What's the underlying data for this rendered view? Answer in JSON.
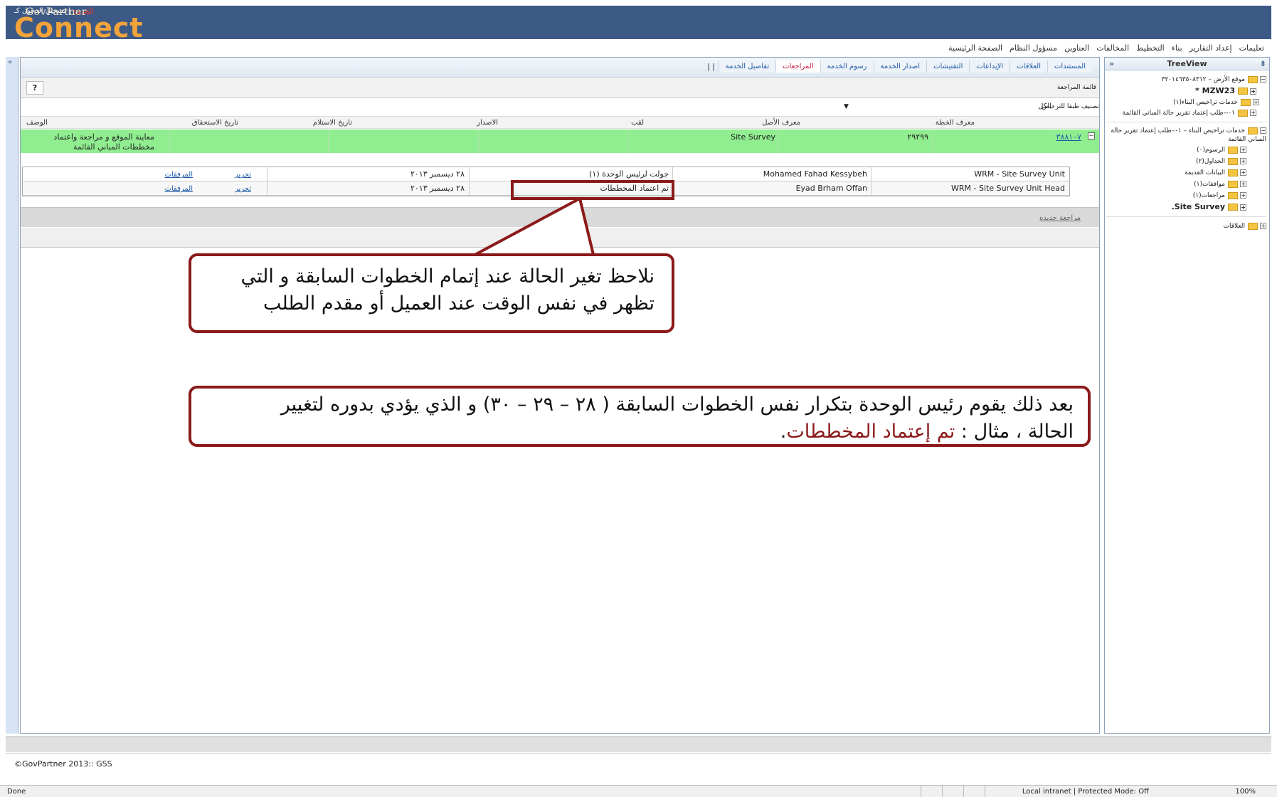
{
  "header": {
    "top_links": "تسجيل الدخول كـ",
    "logout_link": "الخروج",
    "brand_small": "GovPartner",
    "brand": "Connect"
  },
  "menu": [
    "الصفحة الرئيسية",
    "مسؤول النظام",
    "العناوين",
    "المخالفات",
    "التخطيط",
    "بناء",
    "إعداد التقارير",
    "تعليمات"
  ],
  "tabs": [
    {
      "label": "تفاصيل الخدمة",
      "active": false
    },
    {
      "label": "المراجعات",
      "active": true
    },
    {
      "label": "رسوم الخدمة",
      "active": false
    },
    {
      "label": "اصدار الخدمة",
      "active": false
    },
    {
      "label": "التفتيشات",
      "active": false
    },
    {
      "label": "الإيداعات",
      "active": false
    },
    {
      "label": "العلاقات",
      "active": false
    },
    {
      "label": "المستندات",
      "active": false
    }
  ],
  "tab_separator": "| |",
  "main": {
    "list_title": "قائمة المراجعة",
    "help": "?",
    "filter_label": "تصنيف طبقا للترخيص",
    "filter_value": "الكل",
    "columns": {
      "plan_id": "معرف الخطة",
      "asset_id": "معرف الأصل",
      "title": "لقب",
      "version": "الاصدار",
      "received_date": "تاريخ الاستلام",
      "due_date": "تاريخ الاستحقاق",
      "description": "الوصف"
    },
    "row": {
      "plan_link": "٣٨٨١٠٧",
      "plan_id": "٢٩٢٩٩",
      "title": "Site Survey",
      "description": "معاينة الموقع و مراجعة واعتماد مخططات المباني القائمة"
    },
    "sub_rows": [
      {
        "unit": "WRM - Site Survey Unit",
        "person": "Mohamed Fahad Kessybeh",
        "status": "جولت لرئيس الوحدة (١)",
        "date": "٢٨ ديسمبر ٢٠١٣",
        "edit": "تحرير",
        "attachments": "المرفقات"
      },
      {
        "unit": "WRM - Site Survey Unit Head",
        "person": "Eyad Brham Offan",
        "status": "تم اعتماد المخططات",
        "date": "٢٨ ديسمبر ٢٠١٣",
        "edit": "تحرير",
        "attachments": "المرفقات"
      }
    ],
    "new_review": "مراجعة جديدة"
  },
  "tree": {
    "title": "TreeView",
    "nodes": [
      {
        "label": "موقع الأرض – ٣٢٠١٤٦٣٥٠٨٣١٢",
        "bold": false
      },
      {
        "label": "MZW23 *",
        "bold": true
      },
      {
        "label": "خدمات تراخيص البناء(١)",
        "bold": false
      },
      {
        "label": "٠١--طلب إعتماد تقرير حالة المباني القائمة",
        "bold": false
      },
      {
        "label": "خدمات تراخيص البناء – ٠١–طلب إعتماد تقرير حالة المباني القائمة",
        "bold": false
      },
      {
        "label": "الرسوم(٠)",
        "bold": false
      },
      {
        "label": "الجداول(٢)",
        "bold": false
      },
      {
        "label": "البيانات القديمة",
        "bold": false
      },
      {
        "label": "موافقات(١)",
        "bold": false
      },
      {
        "label": "مراجعات(١)",
        "bold": false
      },
      {
        "label": "Site Survey.",
        "bold": true
      },
      {
        "label": "العلاقات",
        "bold": false
      }
    ]
  },
  "footer": {
    "copyright": "©GovPartner 2013:: GSS"
  },
  "statusbar": {
    "done": "Done",
    "zone": "Local intranet | Protected Mode: Off",
    "zoom": "100%"
  },
  "annotations": {
    "callout1_line1": "نلاحظ تغير الحالة عند إتمام الخطوات السابقة و التي",
    "callout1_line2": "تظهر في نفس الوقت عند العميل أو مقدم الطلب",
    "callout2_line1": "بعد ذلك يقوم رئيس الوحدة بتكرار نفس الخطوات السابقة ( ٢٨ – ٢٩ – ٣٠) و الذي يؤدي بدوره لتغيير",
    "callout2_line2_prefix": "الحالة ، مثال : ",
    "callout2_highlight": "تم إعتماد المخططات",
    "callout2_suffix": "."
  },
  "colors": {
    "header_bg": "#3d5a87",
    "row_highlight": "#90ee90",
    "annotation_border": "#8b1a1a",
    "active_tab": "#c7183f"
  }
}
